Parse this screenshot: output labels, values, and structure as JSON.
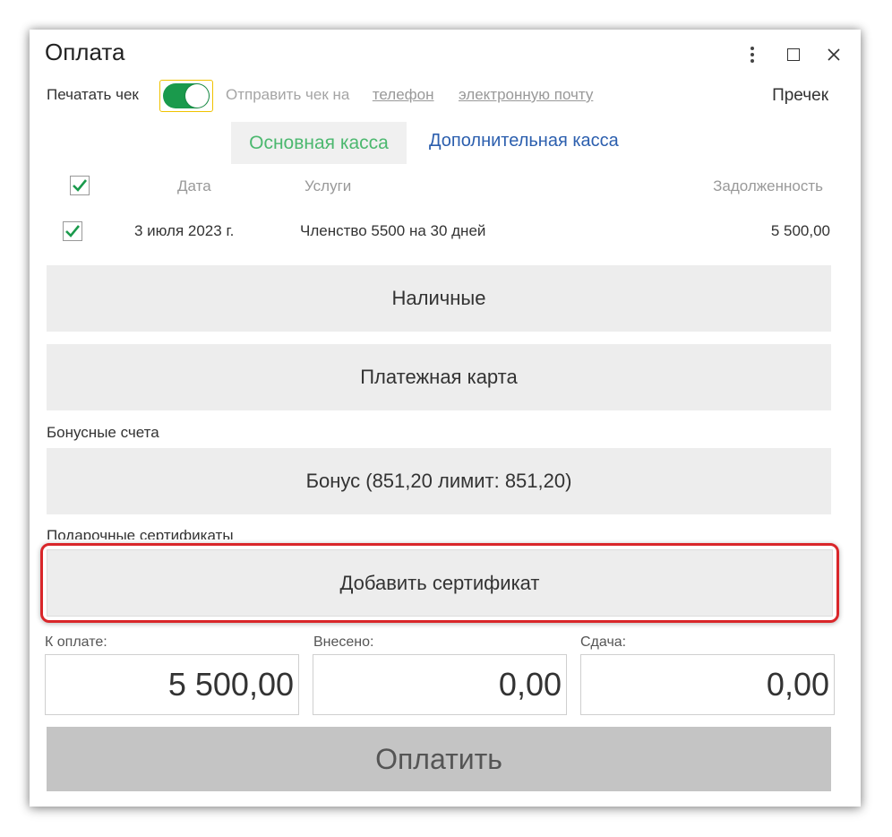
{
  "window": {
    "title": "Оплата",
    "precheck_label": "Пречек"
  },
  "receipt": {
    "print_label": "Печатать чек",
    "print_enabled": true,
    "send_label": "Отправить чек на",
    "phone_link": "телефон",
    "email_link": "электронную почту"
  },
  "tabs": {
    "main": "Основная касса",
    "extra": "Дополнительная касса"
  },
  "table": {
    "headers": {
      "date": "Дата",
      "services": "Услуги",
      "debt": "Задолженность"
    },
    "rows": [
      {
        "checked": true,
        "date": "3 июля 2023 г.",
        "service": "Членство 5500 на 30 дней",
        "debt": "5 500,00"
      }
    ]
  },
  "payments": {
    "cash": "Наличные",
    "card": "Платежная карта",
    "bonus_section": "Бонусные счета",
    "bonus_button": "Бонус (851,20 лимит: 851,20)",
    "gift_section": "Подарочные сертификаты",
    "add_certificate": "Добавить сертификат"
  },
  "totals": {
    "to_pay_label": "К оплате:",
    "to_pay_value": "5 500,00",
    "paid_label": "Внесено:",
    "paid_value": "0,00",
    "change_label": "Сдача:",
    "change_value": "0,00"
  },
  "pay_button": "Оплатить",
  "colors": {
    "toggle_on": "#1a9a4c",
    "main_tab_text": "#4cb86f",
    "extra_tab_text": "#2c5fae",
    "highlight_border": "#d9262a",
    "checkmark": "#1a9a4c"
  }
}
